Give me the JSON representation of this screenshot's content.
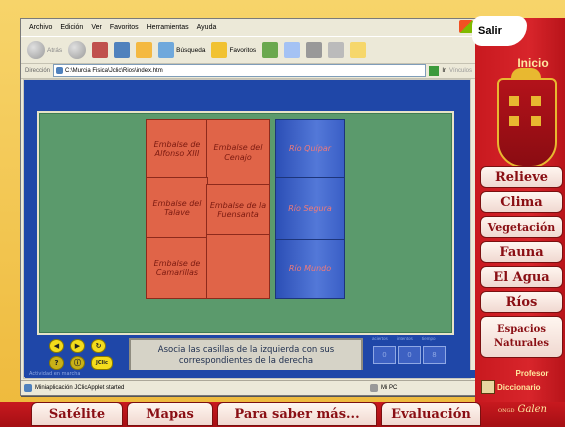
{
  "browser": {
    "menu": [
      "Archivo",
      "Edición",
      "Ver",
      "Favoritos",
      "Herramientas",
      "Ayuda"
    ],
    "toolbar": {
      "back": "Atrás",
      "search": "Búsqueda",
      "favorites": "Favoritos"
    },
    "address_label": "Dirección",
    "address_value": "C:\\Murcia Fisica\\Jclic\\Rios\\index.htm",
    "go_label": "Ir",
    "links_label": "Vínculos",
    "status_left": "Miniaplicación JClicApplet started",
    "status_right": "Mi PC"
  },
  "activity": {
    "left_pieces": [
      "Embalse de Alfonso XIII",
      "Embalse del Cenajo",
      "Embalse del Talave",
      "Embalse de la Fuensanta",
      "Embalse de Camarillas"
    ],
    "right_pieces": [
      "Río Quípar",
      "Río Segura",
      "Río Mundo"
    ],
    "message": "Asocia las casillas de la izquierda con sus correspondientes de la derecha",
    "counters": {
      "labels": [
        "aciertos",
        "intentos",
        "tiempo"
      ],
      "values": [
        "0",
        "0",
        "8"
      ]
    },
    "status": "Actividad en marcha",
    "controls": [
      "◀",
      "▶",
      "↻",
      "?",
      "ⓘ",
      "JClic"
    ]
  },
  "right_panel": {
    "salir": "Salir",
    "inicio": "Inicio",
    "nav": [
      "Relieve",
      "Clima",
      "Vegetación",
      "Fauna",
      "El Agua",
      "Ríos",
      "Espacios Naturales"
    ],
    "profesor": "Profesor",
    "diccionario": "Diccionario"
  },
  "bottom_bar": {
    "buttons": [
      "Satélite",
      "Mapas",
      "Para saber más...",
      "Evaluación"
    ],
    "brand_prefix": "ONGD",
    "brand": "Galen"
  },
  "colors": {
    "panel_red": "#c8191f",
    "piece_red": "#e06448",
    "piece_blue": "#3a5fc6",
    "board_green": "#5b9a6c",
    "frame_yellow": "#f3c64a"
  }
}
